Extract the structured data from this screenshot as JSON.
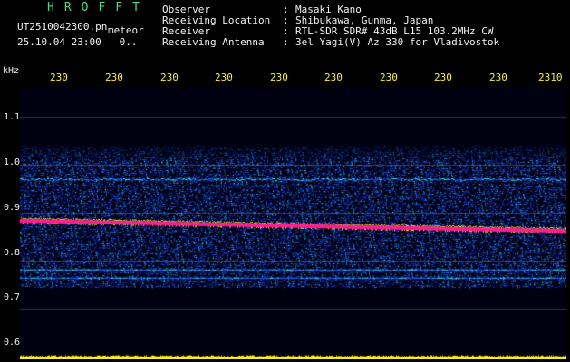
{
  "app": {
    "title": "HROFFT"
  },
  "file": {
    "name": "UT2510042300.pn",
    "suffix": "meteor",
    "date_time": "25.10.04 23:00",
    "count": "0.."
  },
  "meta": [
    {
      "label": "Observer",
      "sep": ":",
      "value": "Masaki Kano"
    },
    {
      "label": "Receiving Location",
      "sep": ":",
      "value": "Shibukawa, Gunma, Japan"
    },
    {
      "label": "Receiver",
      "sep": ":",
      "value": "RTL-SDR SDR# 43dB L15 103.2MHz CW"
    },
    {
      "label": "Receiving Antenna",
      "sep": ":",
      "value": "3el Yagi(V) Az 330 for Vladivostok"
    }
  ],
  "spectrogram": {
    "freq_unit": "kHz",
    "x_tick_labels": [
      "230",
      "230",
      "230",
      "230",
      "230",
      "230",
      "230",
      "230",
      "230",
      "2310"
    ],
    "y_tick_labels": [
      "1.1",
      "1.0",
      "0.9",
      "0.8",
      "0.7",
      "0.6"
    ],
    "y_range_khz": [
      0.6,
      1.15
    ],
    "noise_band_khz": [
      0.745,
      1.04
    ],
    "signal_line_khz": [
      0.883,
      0.862
    ],
    "secondary_line_khz": 0.97,
    "colors": {
      "background": "#000010",
      "noise_low": "#0a1a8a",
      "noise_mid": "#2a6cff",
      "noise_high": "#38e0ff",
      "signal": "#ff1e8c",
      "signal_edge": "#ffe23c",
      "level": "#fff200",
      "grid": "#9a9a9a"
    }
  },
  "colors": {
    "title": "#4ed88a",
    "text": "#f2f2f2",
    "ticks": "#f5ef3c"
  }
}
